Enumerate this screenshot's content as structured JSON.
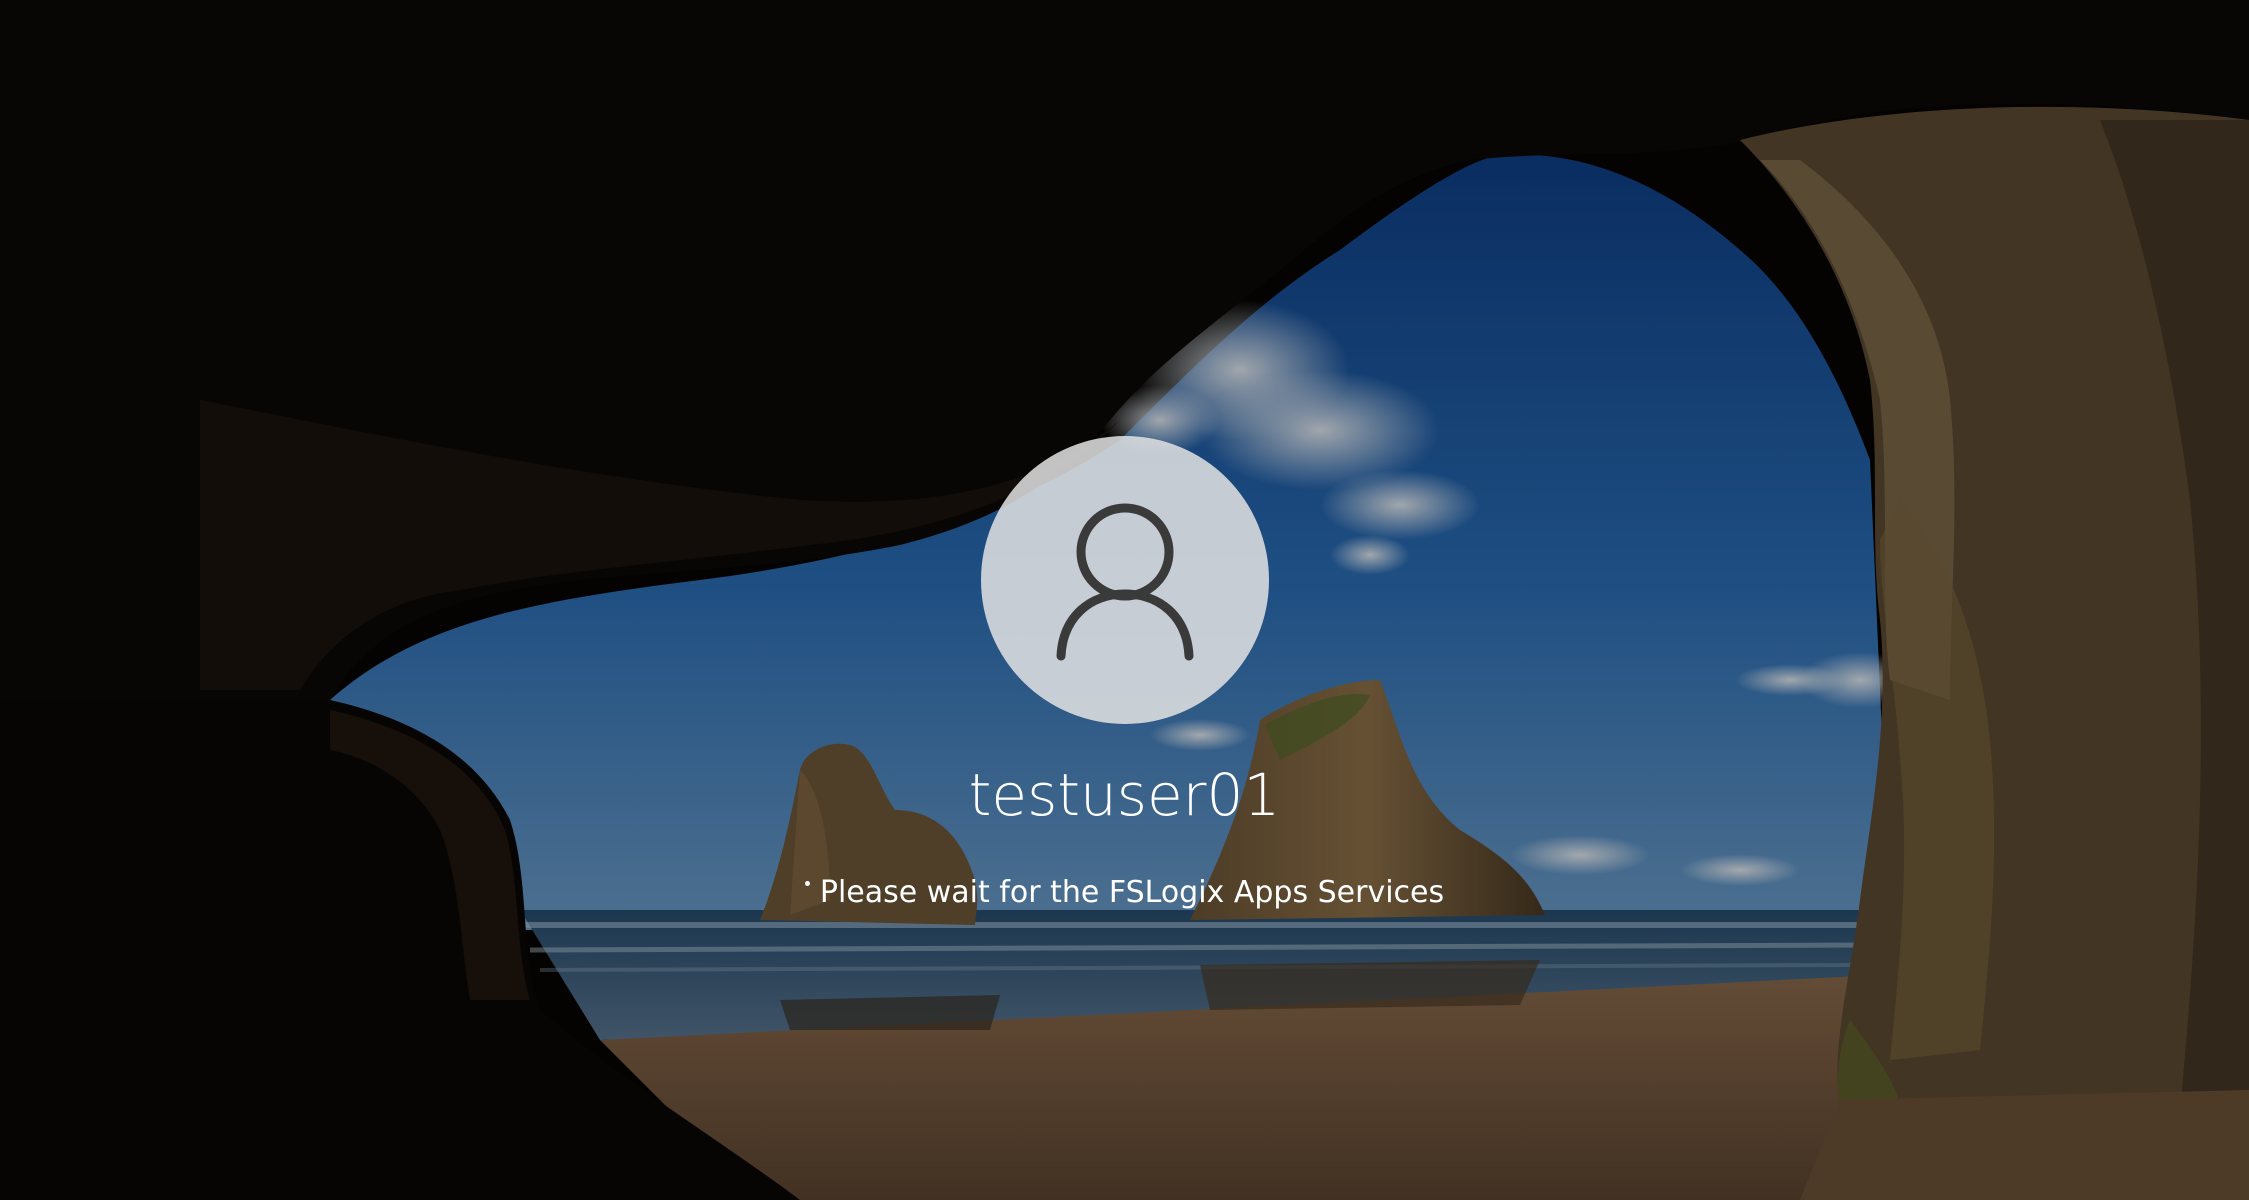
{
  "user": {
    "name": "testuser01",
    "avatar_icon": "user-silhouette-icon"
  },
  "status": {
    "message": "Please wait for the FSLogix Apps Services",
    "spinner_icon": "loading-dot-icon"
  },
  "colors": {
    "text": "#ffffff",
    "avatar_bg": "#e2e2e2",
    "avatar_icon": "#3a3a3a",
    "sky": "#1f5fa8",
    "cave": "#0a0806"
  }
}
